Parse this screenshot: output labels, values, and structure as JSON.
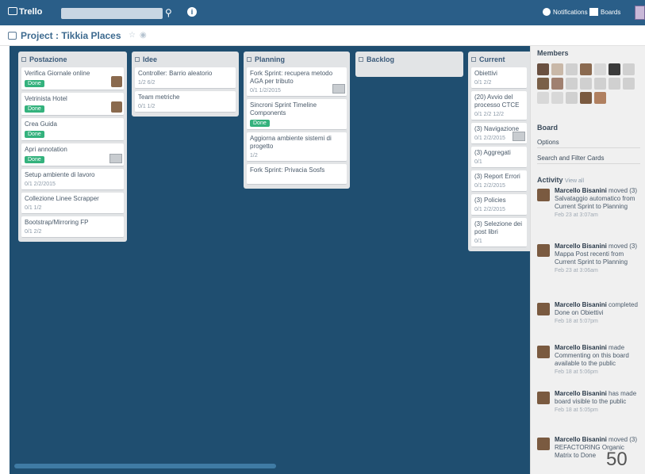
{
  "topbar": {
    "logo": "Trello",
    "search_placeholder": "",
    "notifications_label": "Notifications",
    "boards_label": "Boards"
  },
  "board": {
    "title": "Project : Tikkia Places"
  },
  "lists": [
    {
      "title": "Postazione",
      "cards": [
        {
          "title": "Verifica Giornale online",
          "label": "Done",
          "meta": "",
          "avatar": true
        },
        {
          "title": "Vetrinista Hotel",
          "label": "Done",
          "meta": "",
          "avatar": true
        },
        {
          "title": "Crea Guida",
          "label": "Done",
          "meta": "",
          "avatar": false
        },
        {
          "title": "Apri annotation",
          "label": "Done",
          "meta": "",
          "avatar": false,
          "attach": true
        },
        {
          "title": "Setup ambiente di lavoro",
          "label": "",
          "meta": "0/1  2/2/2015",
          "avatar": false
        },
        {
          "title": "Collezione Linee Scrapper",
          "label": "",
          "meta": "0/1  1/2",
          "avatar": false
        },
        {
          "title": "Bootstrap/Mirroring FP",
          "label": "",
          "meta": "0/1  2/2",
          "avatar": false
        }
      ]
    },
    {
      "title": "Idee",
      "cards": [
        {
          "title": "Controller: Barrio aleatorio",
          "label": "",
          "meta": "1/2  6/2",
          "avatar": false
        },
        {
          "title": "Team metriche",
          "label": "",
          "meta": "0/1  1/2",
          "avatar": false
        }
      ]
    },
    {
      "title": "Planning",
      "cards": [
        {
          "title": "Fork Sprint: recupera metodo AGA per tributo",
          "label": "",
          "meta": "0/1  1/2/2015",
          "avatar": false,
          "attach": true
        },
        {
          "title": "Sincroni Sprint Timeline Components",
          "label": "Done",
          "meta": "",
          "avatar": false
        },
        {
          "title": "Aggiorna ambiente sistemi di progetto",
          "label": "",
          "meta": "1/2",
          "avatar": false
        },
        {
          "title": "Fork Sprint: Privacia Sosfs",
          "label": "",
          "meta": "",
          "avatar": false
        }
      ]
    },
    {
      "title": "Backlog",
      "cards": []
    },
    {
      "title": "Current Sprint",
      "cards": [
        {
          "title": "Obiettivi",
          "label": "",
          "meta": "0/1  2/2",
          "avatar": false
        },
        {
          "title": "(20) Avvio del processo CTCE",
          "label": "",
          "meta": "0/1  2/2  12/2",
          "avatar": false
        },
        {
          "title": "(3) Navigazione",
          "label": "",
          "meta": "0/1  2/2/2015",
          "avatar": false,
          "attach": true
        },
        {
          "title": "(3) Aggregati",
          "label": "",
          "meta": "0/1",
          "avatar": false
        },
        {
          "title": "(3) Report Errori",
          "label": "",
          "meta": "0/1  2/2/2015",
          "avatar": false
        },
        {
          "title": "(3) Policies",
          "label": "",
          "meta": "0/1  2/2/2015",
          "avatar": false
        },
        {
          "title": "(3) Selezione dei post libri",
          "label": "",
          "meta": "0/1",
          "avatar": false
        }
      ]
    }
  ],
  "sidebar": {
    "members_title": "Members",
    "board_title": "Board",
    "options": [
      "Options",
      "Search and Filter Cards"
    ],
    "activity_title": "Activity",
    "activity_link": "View all",
    "activity": [
      {
        "user": "Marcello Bisanini",
        "text": "moved (3) Salvataggio automatico from Current Sprint to Planning",
        "time": "Feb 23 at 3:07am"
      },
      {
        "user": "Marcello Bisanini",
        "text": "moved (3) Mappa Post recenti from Current Sprint to Planning",
        "time": "Feb 23 at 3:06am"
      },
      {
        "user": "Marcello Bisanini",
        "text": "completed Done on Obiettivi",
        "time": "Feb 18 at 5:07pm"
      },
      {
        "user": "Marcello Bisanini",
        "text": "made Commenting on this board available to the public",
        "time": "Feb 18 at 5:06pm"
      },
      {
        "user": "Marcello Bisanini",
        "text": "has made board visible to the public",
        "time": "Feb 18 at 5:05pm"
      },
      {
        "user": "Marcello Bisanini",
        "text": "moved (3) REFACTORING Organic Matrix to Done",
        "time": ""
      }
    ]
  },
  "page_number": "50"
}
